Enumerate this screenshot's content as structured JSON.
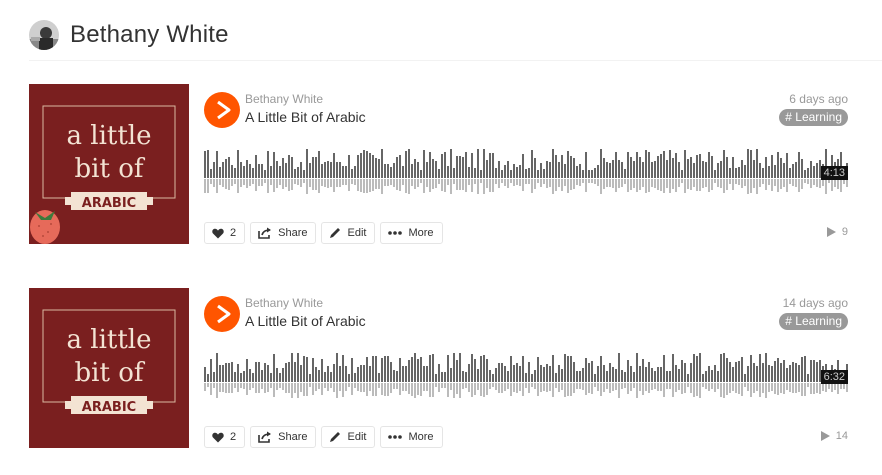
{
  "profile": {
    "name": "Bethany White"
  },
  "tracks": [
    {
      "uploader": "Bethany White",
      "title": "A Little Bit of Arabic",
      "posted": "6 days ago",
      "tag": "# Learning",
      "duration": "4:13",
      "likes": "2",
      "share_label": "Share",
      "edit_label": "Edit",
      "more_label": "More",
      "plays": "9",
      "artwork": {
        "line1": "a little",
        "line2": "bit of",
        "line3": "ARABIC",
        "has_strawberry": true
      }
    },
    {
      "uploader": "Bethany White",
      "title": "A Little Bit of Arabic",
      "posted": "14 days ago",
      "tag": "# Learning",
      "duration": "6:32",
      "likes": "2",
      "share_label": "Share",
      "edit_label": "Edit",
      "more_label": "More",
      "plays": "14",
      "artwork": {
        "line1": "a little",
        "line2": "bit of",
        "line3": "ARABIC",
        "has_strawberry": false
      }
    }
  ],
  "colors": {
    "accent": "#ff5500",
    "artwork_bg": "#7a1f1f",
    "tag_bg": "#999999"
  }
}
